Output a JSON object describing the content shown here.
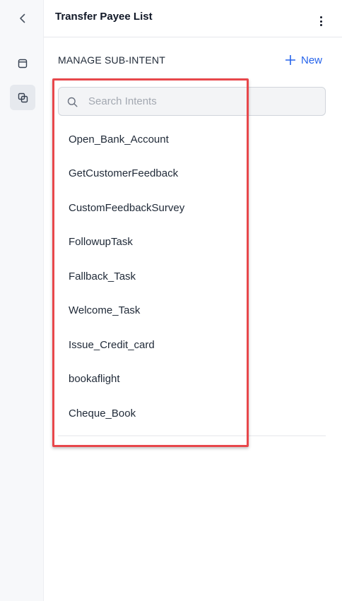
{
  "header": {
    "title": "Transfer Payee List"
  },
  "icons": {
    "back": "chevron-left-icon",
    "screen": "window-icon",
    "sub_intent": "copy-icon",
    "more": "kebab-icon",
    "search": "search-icon",
    "add": "plus-icon"
  },
  "section": {
    "title": "MANAGE SUB-INTENT",
    "new_label": "New"
  },
  "search": {
    "placeholder": "Search Intents",
    "value": ""
  },
  "intents": [
    "Open_Bank_Account",
    "GetCustomerFeedback",
    "CustomFeedbackSurvey",
    "FollowupTask",
    "Fallback_Task",
    "Welcome_Task",
    "Issue_Credit_card",
    "bookaflight",
    "Cheque_Book"
  ],
  "colors": {
    "accent": "#2563eb",
    "highlight": "#e8474b"
  }
}
